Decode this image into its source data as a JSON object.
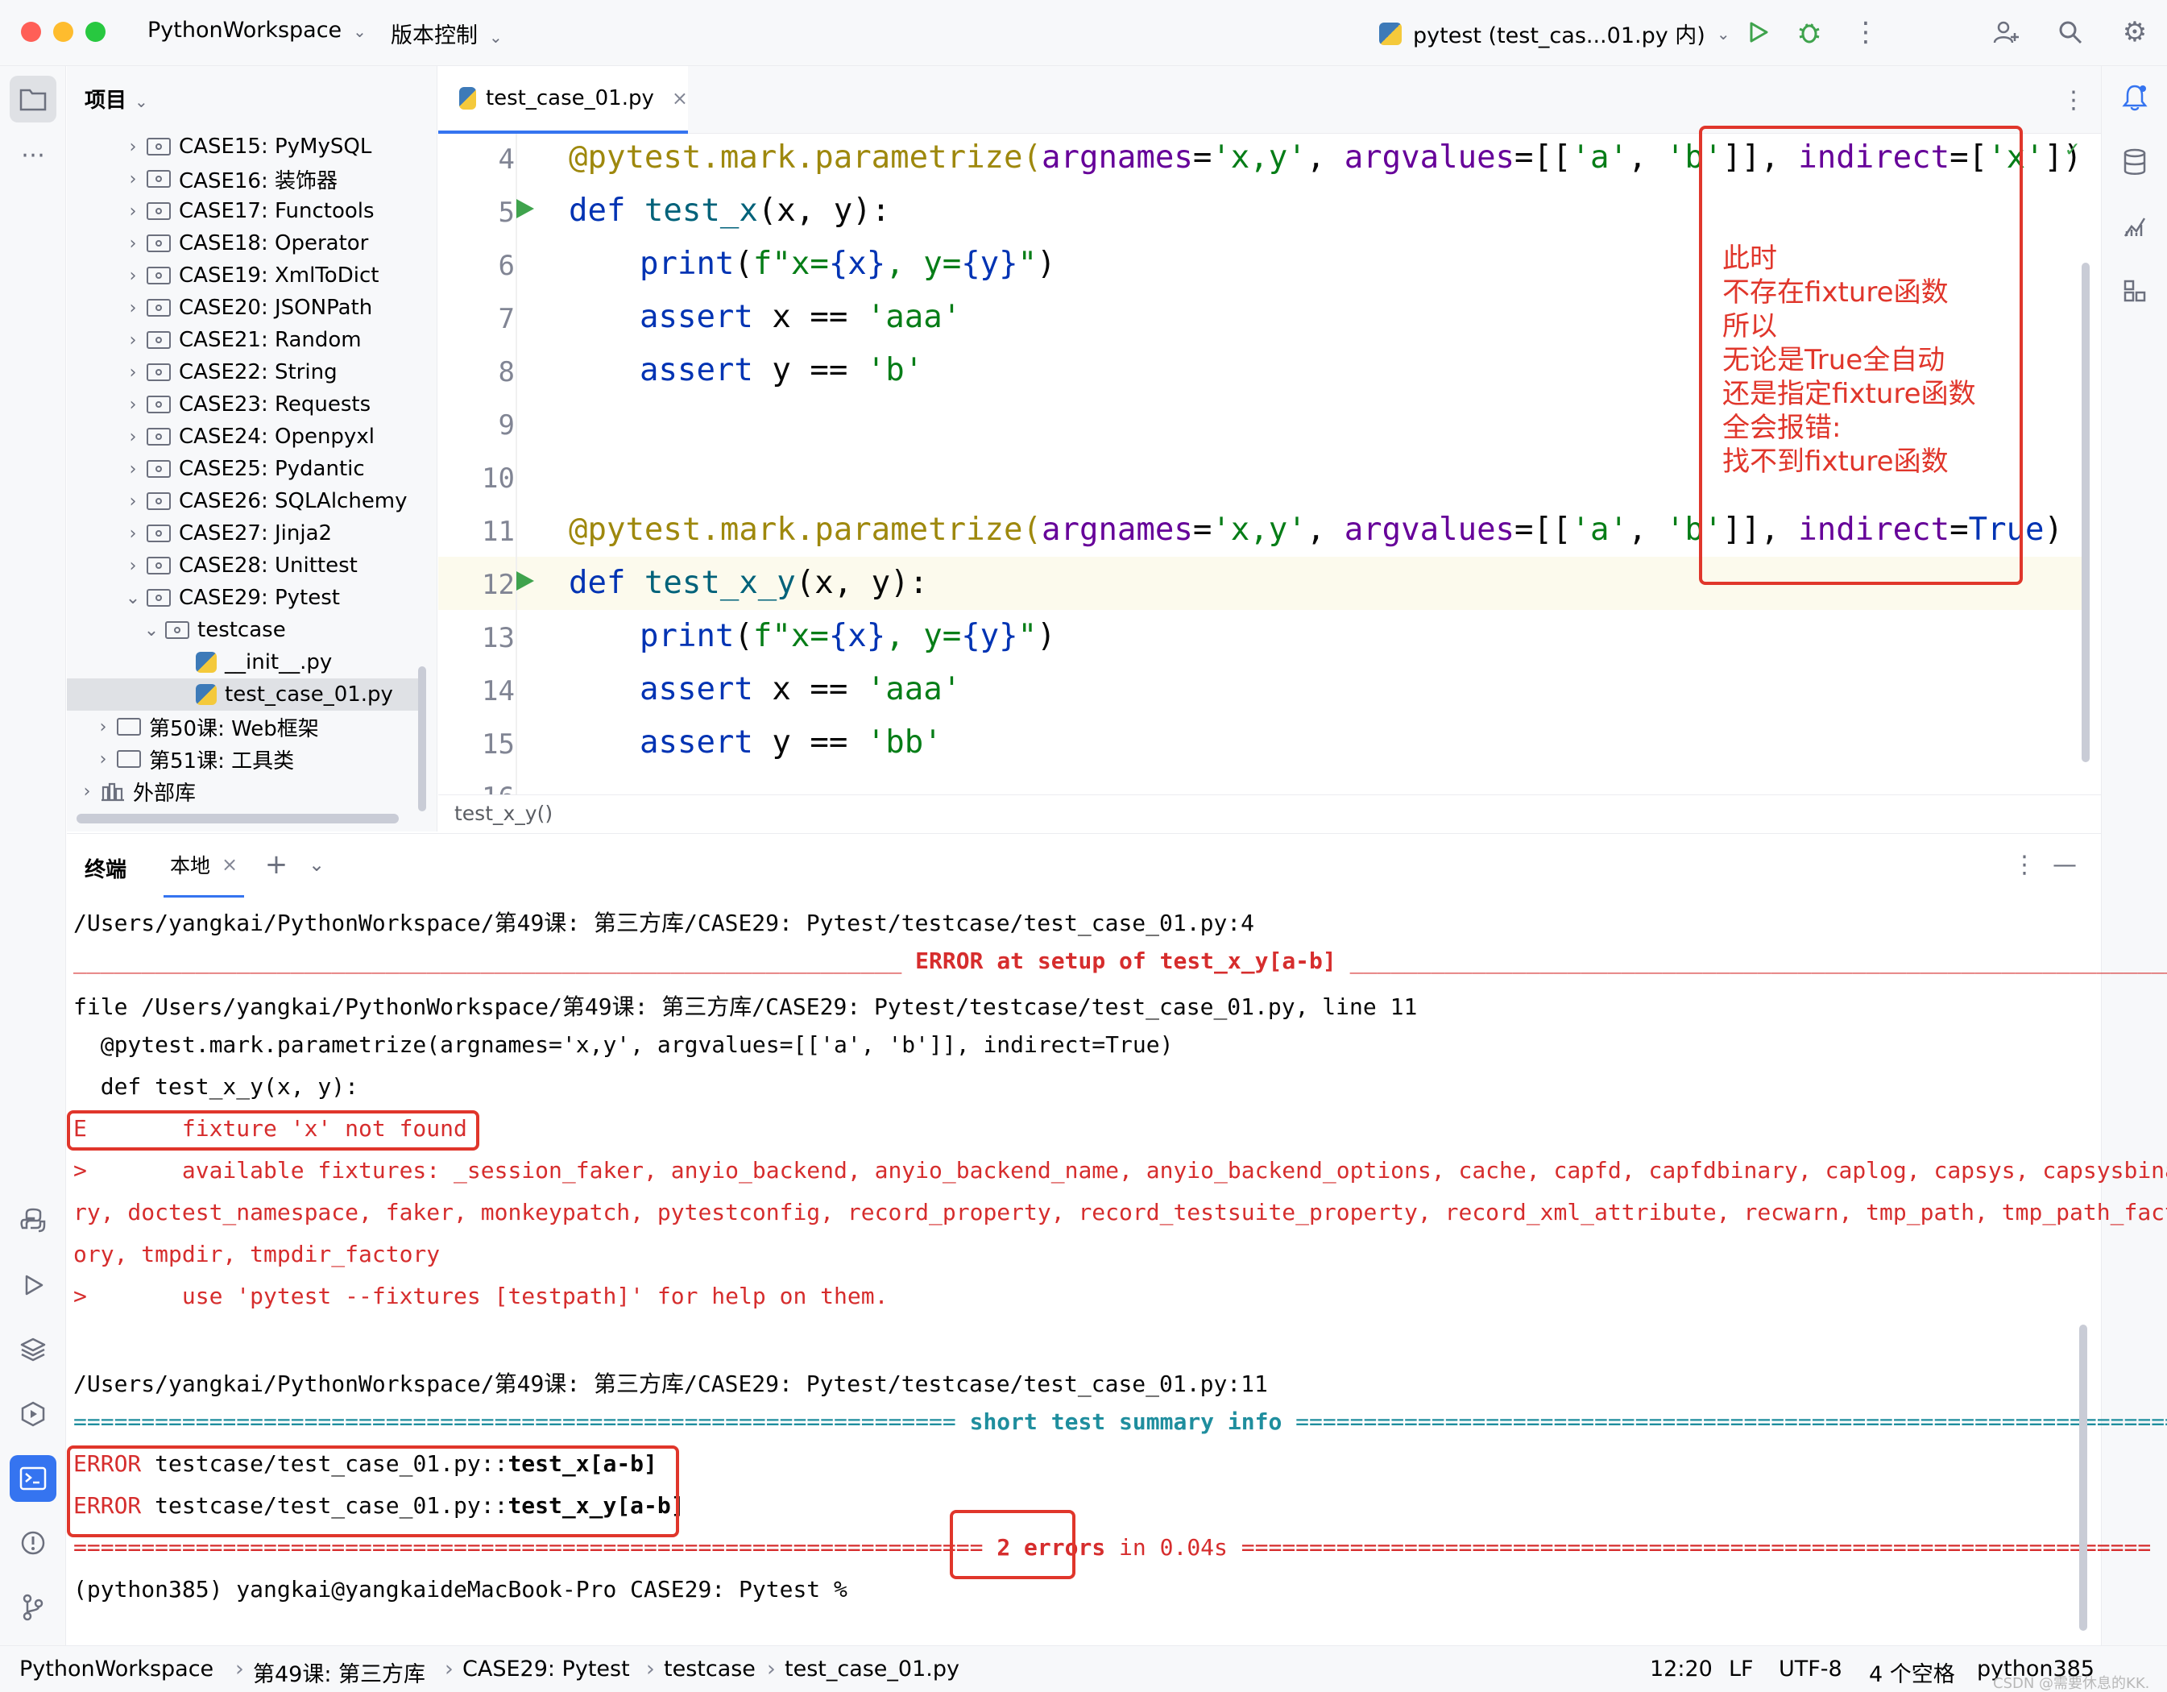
{
  "titlebar": {
    "project": "PythonWorkspace",
    "vcs": "版本控制",
    "run_config": "pytest (test_cas...01.py 内)"
  },
  "project_panel": {
    "title": "项目",
    "items": [
      {
        "label": "CASE15: PyMySQL",
        "depth": 2,
        "kind": "pkg",
        "expanded": false
      },
      {
        "label": "CASE16: 装饰器",
        "depth": 2,
        "kind": "pkg",
        "expanded": false
      },
      {
        "label": "CASE17: Functools",
        "depth": 2,
        "kind": "pkg",
        "expanded": false
      },
      {
        "label": "CASE18: Operator",
        "depth": 2,
        "kind": "pkg",
        "expanded": false
      },
      {
        "label": "CASE19: XmlToDict",
        "depth": 2,
        "kind": "pkg",
        "expanded": false
      },
      {
        "label": "CASE20: JSONPath",
        "depth": 2,
        "kind": "pkg",
        "expanded": false
      },
      {
        "label": "CASE21: Random",
        "depth": 2,
        "kind": "pkg",
        "expanded": false
      },
      {
        "label": "CASE22: String",
        "depth": 2,
        "kind": "pkg",
        "expanded": false
      },
      {
        "label": "CASE23: Requests",
        "depth": 2,
        "kind": "pkg",
        "expanded": false
      },
      {
        "label": "CASE24: Openpyxl",
        "depth": 2,
        "kind": "pkg",
        "expanded": false
      },
      {
        "label": "CASE25: Pydantic",
        "depth": 2,
        "kind": "pkg",
        "expanded": false
      },
      {
        "label": "CASE26: SQLAlchemy",
        "depth": 2,
        "kind": "pkg",
        "expanded": false
      },
      {
        "label": "CASE27: Jinja2",
        "depth": 2,
        "kind": "pkg",
        "expanded": false
      },
      {
        "label": "CASE28: Unittest",
        "depth": 2,
        "kind": "pkg",
        "expanded": false
      },
      {
        "label": "CASE29: Pytest",
        "depth": 2,
        "kind": "pkg",
        "expanded": true
      },
      {
        "label": "testcase",
        "depth": 3,
        "kind": "pkg",
        "expanded": true
      },
      {
        "label": "__init__.py",
        "depth": 4,
        "kind": "py"
      },
      {
        "label": "test_case_01.py",
        "depth": 4,
        "kind": "py",
        "selected": true
      },
      {
        "label": "第50课: Web框架",
        "depth": 1,
        "kind": "folder",
        "expanded": false
      },
      {
        "label": "第51课: 工具类",
        "depth": 1,
        "kind": "folder",
        "expanded": false
      },
      {
        "label": "外部库",
        "depth": 0,
        "kind": "lib",
        "expanded": false
      }
    ]
  },
  "editor": {
    "tab": "test_case_01.py",
    "breadcrumb": "test_x_y()",
    "line_numbers": [
      "4",
      "5",
      "6",
      "7",
      "8",
      "9",
      "10",
      "11",
      "12",
      "13",
      "14",
      "15",
      "16"
    ],
    "lines": {
      "l4": {
        "a": "@pytest.mark.parametrize(",
        "b": "argnames",
        "c": "=",
        "d": "'x,y'",
        "e": ", ",
        "f": "argvalues",
        "g": "=[[",
        "h": "'a'",
        "i": ", ",
        "j": "'b'",
        "k": "]], ",
        "l": "indirect",
        "m": "=[",
        "n": "'x'",
        "o": "])"
      },
      "l5": {
        "a": "def ",
        "b": "test_x",
        "c": "(x, y):"
      },
      "l6": {
        "a": "print",
        "b": "(",
        "c": "f\"x=",
        "d": "{x}",
        "e": ", y=",
        "f": "{y}",
        "g": "\"",
        "h": ")"
      },
      "l7": {
        "a": "assert ",
        "b": "x == ",
        "c": "'aaa'"
      },
      "l8": {
        "a": "assert ",
        "b": "y == ",
        "c": "'b'"
      },
      "l11": {
        "a": "@pytest.mark.parametrize(",
        "b": "argnames",
        "c": "=",
        "d": "'x,y'",
        "e": ", ",
        "f": "argvalues",
        "g": "=[[",
        "h": "'a'",
        "i": ", ",
        "j": "'b'",
        "k": "]], ",
        "l": "indirect",
        "m": "=",
        "n": "True",
        "o": ")"
      },
      "l12": {
        "a": "def ",
        "b": "test_x_y",
        "c": "(x, y):"
      },
      "l13": {
        "a": "print",
        "b": "(",
        "c": "f\"x=",
        "d": "{x}",
        "e": ", y=",
        "f": "{y}",
        "g": "\"",
        "h": ")"
      },
      "l14": {
        "a": "assert ",
        "b": "x == ",
        "c": "'aaa'"
      },
      "l15": {
        "a": "assert ",
        "b": "y == ",
        "c": "'bb'"
      }
    }
  },
  "annotation": {
    "lines": [
      "此时",
      "不存在fixture函数",
      "所以",
      "无论是True全自动",
      "还是指定fixture函数",
      "全会报错:",
      "找不到fixture函数"
    ]
  },
  "terminal": {
    "tab_title": "终端",
    "tab_local": "本地",
    "lines": {
      "t1": "/Users/yangkai/PythonWorkspace/第49课: 第三方库/CASE29: Pytest/testcase/test_case_01.py:4",
      "t2a": "_____________________________________________________________ ",
      "t2b": "ERROR at setup of test_x_y[a-b]",
      "t2c": " ______________________________________________________________",
      "t3": "file /Users/yangkai/PythonWorkspace/第49课: 第三方库/CASE29: Pytest/testcase/test_case_01.py, line 11",
      "t4": "  @pytest.mark.parametrize(argnames='x,y', argvalues=[['a', 'b']], indirect=True)",
      "t5": "  def test_x_y(x, y):",
      "t6": "E       fixture 'x' not found",
      "t7": ">       available fixtures: _session_faker, anyio_backend, anyio_backend_name, anyio_backend_options, cache, capfd, capfdbinary, caplog, capsys, capsysbina",
      "t8": "ry, doctest_namespace, faker, monkeypatch, pytestconfig, record_property, record_testsuite_property, record_xml_attribute, recwarn, tmp_path, tmp_path_fact",
      "t9": "ory, tmpdir, tmpdir_factory",
      "t10": ">       use 'pytest --fixtures [testpath]' for help on them.",
      "t11": "/Users/yangkai/PythonWorkspace/第49课: 第三方库/CASE29: Pytest/testcase/test_case_01.py:11",
      "t12a": "================================================================= ",
      "t12b": "short test summary info",
      "t12c": " ==================================================================",
      "t13a": "ERROR ",
      "t13b": "testcase/test_case_01.py::",
      "t13c": "test_x[a-b]",
      "t14a": "ERROR ",
      "t14b": "testcase/test_case_01.py::",
      "t14c": "test_x_y[a-b]",
      "t15a": "=================================================================== ",
      "t15b": "2 errors",
      "t15c": " in 0.04s",
      "t15d": " ===================================================================",
      "t16": "(python385) yangkai@yangkaideMacBook-Pro CASE29: Pytest % "
    }
  },
  "statusbar": {
    "crumbs": [
      "PythonWorkspace",
      "第49课: 第三方库",
      "CASE29: Pytest",
      "testcase",
      "test_case_01.py"
    ],
    "position": "12:20",
    "line_sep": "LF",
    "encoding": "UTF-8",
    "indent": "4 个空格",
    "interpreter": "python385",
    "watermark": "CSDN @需要休息的KK."
  },
  "colors": {
    "accent": "#3574f0",
    "error": "#d62d2d",
    "annotation": "#e0362b",
    "run": "#3fa34d"
  }
}
